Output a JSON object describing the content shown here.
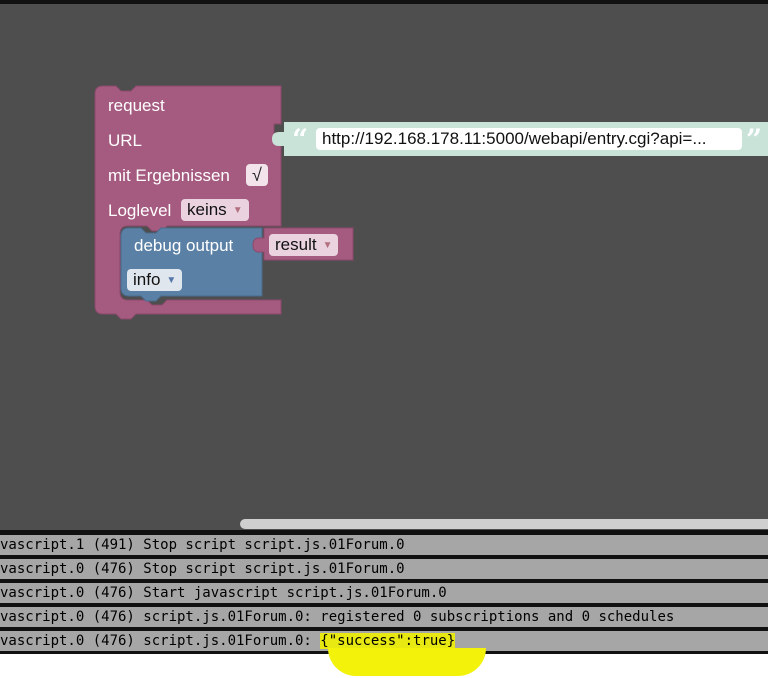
{
  "blocks": {
    "request": {
      "title": "request",
      "url_label": "URL",
      "url_value": "http://192.168.178.11:5000/webapi/entry.cgi?api=...",
      "quote_open": "“",
      "quote_close": "”",
      "results_label": "mit Ergebnissen",
      "results_checked": "√",
      "loglevel_label": "Loglevel",
      "loglevel_value": "keins",
      "color": "#a55b80"
    },
    "debug": {
      "title": "debug output",
      "variable": "result",
      "level": "info",
      "color": "#5b80a5"
    },
    "url_string_color": "#c9e3d8",
    "dropdown_arrow": "▼"
  },
  "console": {
    "lines": [
      "vascript.1 (491) Stop script script.js.01Forum.0",
      "vascript.0 (476) Stop script script.js.01Forum.0",
      "vascript.0 (476) Start javascript script.js.01Forum.0",
      "vascript.0 (476) script.js.01Forum.0: registered 0 subscriptions and 0 schedules",
      "vascript.0 (476) script.js.01Forum.0: "
    ],
    "highlighted": "{\"success\":true}"
  }
}
